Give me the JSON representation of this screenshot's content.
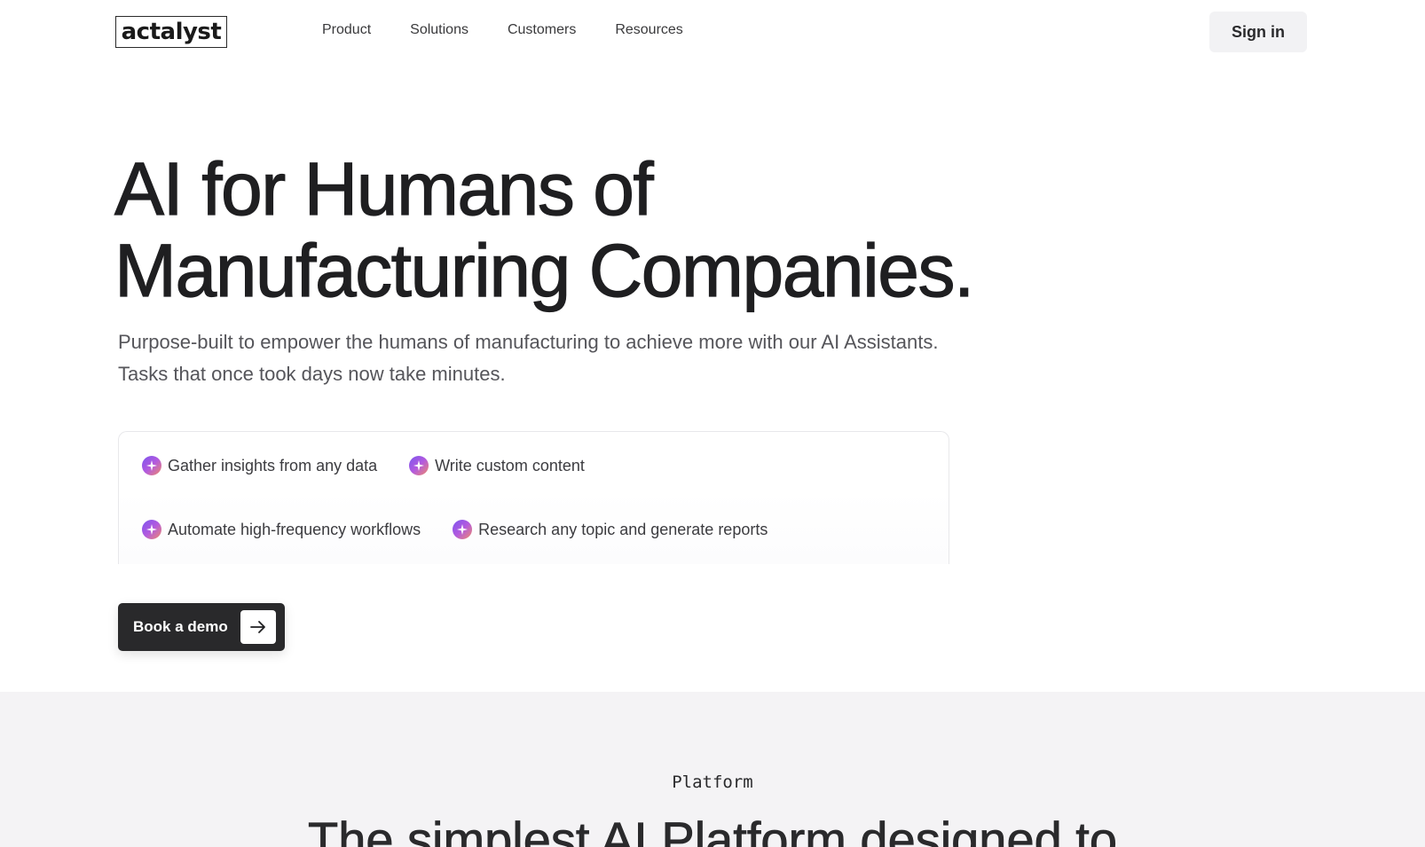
{
  "header": {
    "logo_text": "actalyst",
    "nav": [
      {
        "label": "Product"
      },
      {
        "label": "Solutions"
      },
      {
        "label": "Customers"
      },
      {
        "label": "Resources"
      }
    ],
    "signin_label": "Sign in"
  },
  "hero": {
    "title_line1": "AI for Humans of",
    "title_line2": "Manufacturing Companies.",
    "subtitle_line1": "Purpose-built to empower the humans of manufacturing to achieve more with our AI Assistants.",
    "subtitle_line2": "Tasks that once took days now take minutes."
  },
  "features": [
    {
      "label": "Gather insights from any data",
      "icon": "sparkle-icon"
    },
    {
      "label": "Write custom content",
      "icon": "sparkle-icon"
    },
    {
      "label": "Automate high-frequency workflows",
      "icon": "sparkle-icon"
    },
    {
      "label": "Research any topic and generate reports",
      "icon": "sparkle-icon"
    }
  ],
  "cta": {
    "label": "Book a demo",
    "icon": "arrow-right-icon"
  },
  "platform": {
    "eyebrow": "Platform",
    "heading": "The simplest AI Platform designed to"
  },
  "colors": {
    "text_primary": "#1f1f21",
    "text_secondary": "#55555a",
    "cta_background": "#29292b",
    "section_background": "#f4f3f5",
    "sparkle_gradient": [
      "#7b55ee",
      "#b25adf",
      "#f08a6a"
    ]
  }
}
